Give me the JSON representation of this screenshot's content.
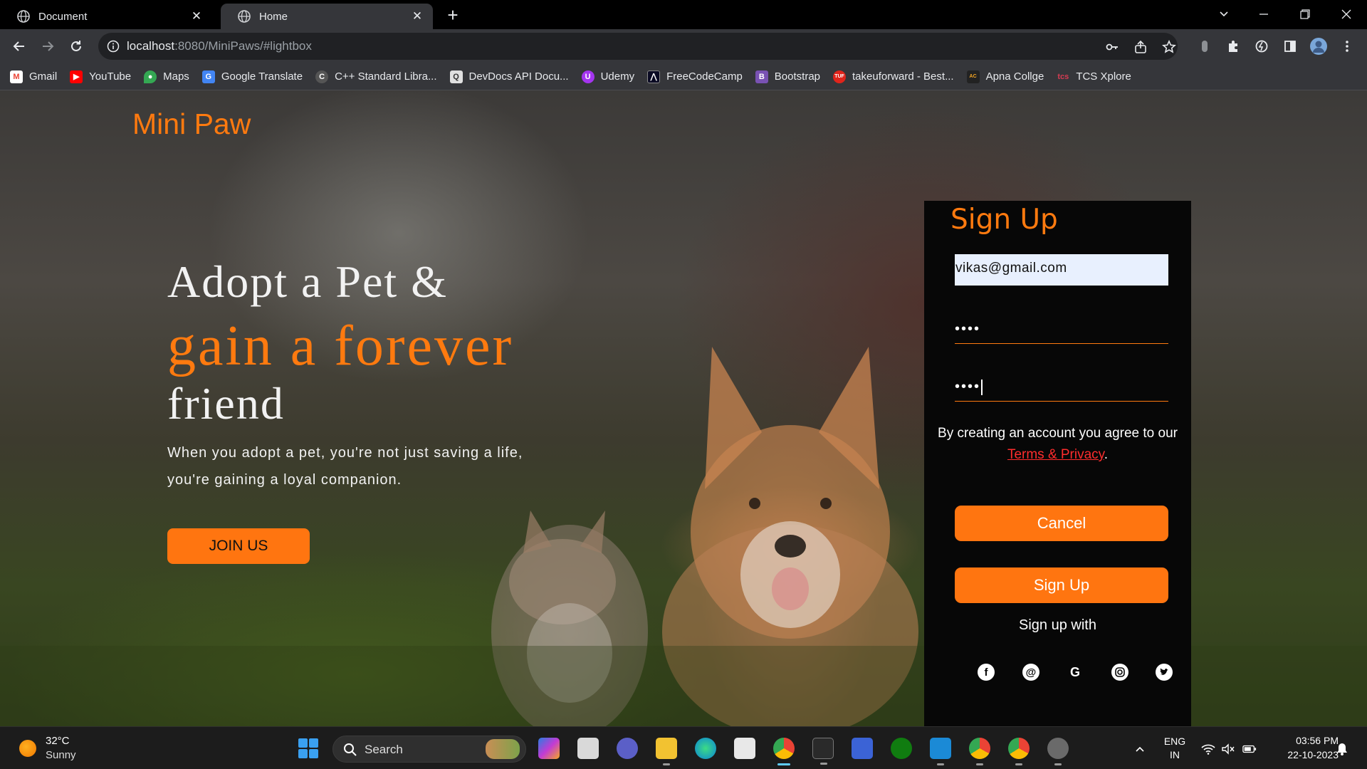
{
  "browser": {
    "tabs": [
      {
        "title": "Document",
        "active": false
      },
      {
        "title": "Home",
        "active": true
      }
    ],
    "url_host": "localhost",
    "url_rest": ":8080/MiniPaws/#lightbox",
    "bookmarks": [
      {
        "label": "Gmail",
        "icon": "gmail-icon",
        "color": "#ea4335"
      },
      {
        "label": "YouTube",
        "icon": "youtube-icon",
        "color": "#ff0000"
      },
      {
        "label": "Maps",
        "icon": "maps-icon",
        "color": "#34a853"
      },
      {
        "label": "Google Translate",
        "icon": "translate-icon",
        "color": "#4285f4"
      },
      {
        "label": "C++ Standard Libra...",
        "icon": "cpp-icon",
        "color": "#555555"
      },
      {
        "label": "DevDocs API Docu...",
        "icon": "devdocs-icon",
        "color": "#e0e0e0"
      },
      {
        "label": "Udemy",
        "icon": "udemy-icon",
        "color": "#a435f0"
      },
      {
        "label": "FreeCodeCamp",
        "icon": "freecodecamp-icon",
        "color": "#0a0a23"
      },
      {
        "label": "Bootstrap",
        "icon": "bootstrap-icon",
        "color": "#7952b3"
      },
      {
        "label": "takeuforward - Best...",
        "icon": "takeuforward-icon",
        "color": "#e0241b"
      },
      {
        "label": "Apna Collge",
        "icon": "apna-college-icon",
        "color": "#f5a623"
      },
      {
        "label": "TCS Xplore",
        "icon": "tcs-icon",
        "color": "#d63b52"
      }
    ]
  },
  "page": {
    "brand": "Mini Paw",
    "hero": {
      "line1": "Adopt a Pet &",
      "line2": "gain a forever",
      "line3": "friend",
      "description": "When you adopt a pet, you're not just saving a life, you're gaining a loyal companion.",
      "cta": "JOIN US"
    },
    "signup": {
      "title": "Sign Up",
      "email_value": "vikas@gmail.com",
      "password_mask": "••••",
      "confirm_mask": "••••",
      "agree_text": "By creating an account you agree to our",
      "terms_link": "Terms & Privacy",
      "terms_suffix": ".",
      "cancel_label": "Cancel",
      "submit_label": "Sign Up",
      "signup_with": "Sign up with",
      "socials": [
        "facebook-icon",
        "threads-icon",
        "google-icon",
        "instagram-icon",
        "twitter-icon"
      ]
    },
    "colors": {
      "accent": "#ff7510",
      "panel": "#070707",
      "link": "#ff2d2d"
    }
  },
  "taskbar": {
    "weather_temp": "32°C",
    "weather_cond": "Sunny",
    "search_label": "Search",
    "lang_top": "ENG",
    "lang_bottom": "IN",
    "time": "03:56 PM",
    "date": "22-10-2023"
  }
}
